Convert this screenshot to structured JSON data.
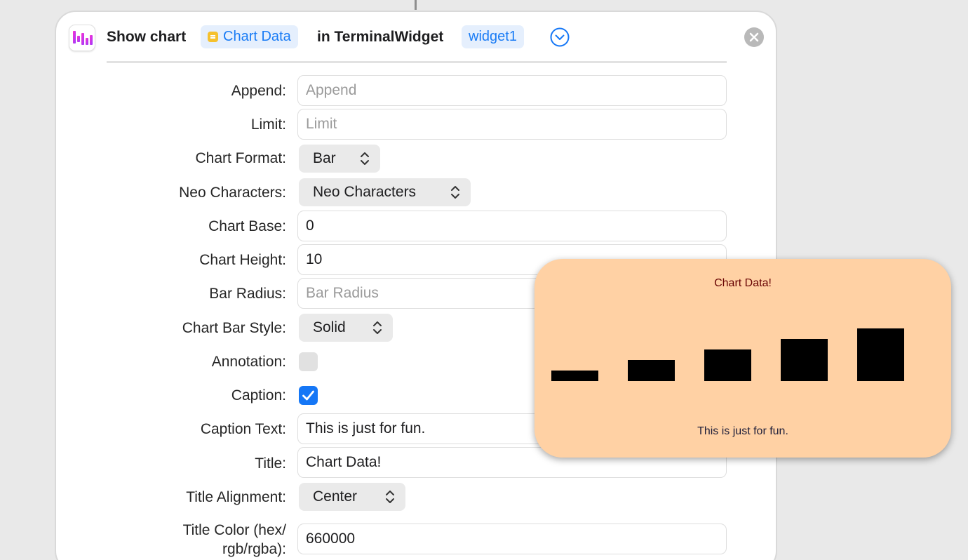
{
  "header": {
    "action": "Show chart",
    "variable_token": "Chart Data",
    "preposition": "in TerminalWidget",
    "widget_token": "widget1"
  },
  "form": {
    "append": {
      "label": "Append:",
      "value": "",
      "placeholder": "Append"
    },
    "limit": {
      "label": "Limit:",
      "value": "",
      "placeholder": "Limit"
    },
    "chart_format": {
      "label": "Chart Format:",
      "value": "Bar"
    },
    "neo_characters": {
      "label": "Neo Characters:",
      "value": "Neo Characters"
    },
    "chart_base": {
      "label": "Chart Base:",
      "value": "0"
    },
    "chart_height": {
      "label": "Chart Height:",
      "value": "10"
    },
    "bar_radius": {
      "label": "Bar Radius:",
      "value": "",
      "placeholder": "Bar Radius"
    },
    "chart_bar_style": {
      "label": "Chart Bar Style:",
      "value": "Solid"
    },
    "annotation": {
      "label": "Annotation:",
      "checked": false
    },
    "caption": {
      "label": "Caption:",
      "checked": true
    },
    "caption_text": {
      "label": "Caption Text:",
      "value": "This is just for fun."
    },
    "title": {
      "label": "Title:",
      "value": "Chart Data!"
    },
    "title_alignment": {
      "label": "Title Alignment:",
      "value": "Center"
    },
    "title_color": {
      "label_line1": "Title Color (hex/",
      "label_line2": "rgb/rgba):",
      "value": "660000"
    }
  },
  "colors": {
    "accent": "#1577f6",
    "token_bg": "#e5effd",
    "preview_bg": "#ffd1a4",
    "preview_title": "#660000",
    "bar": "#000000"
  },
  "icons": {
    "app": "bar-chart-icon",
    "expand": "chevron-down-circle-icon",
    "close": "close-icon",
    "popup": "up-down-chevron-icon",
    "check": "checkmark-icon"
  },
  "chart_data": {
    "type": "bar",
    "title": "Chart Data!",
    "caption": "This is just for fun.",
    "values": [
      1,
      2,
      3,
      4,
      5
    ],
    "ylim": [
      0,
      10
    ],
    "grid": false,
    "legend": "none"
  }
}
